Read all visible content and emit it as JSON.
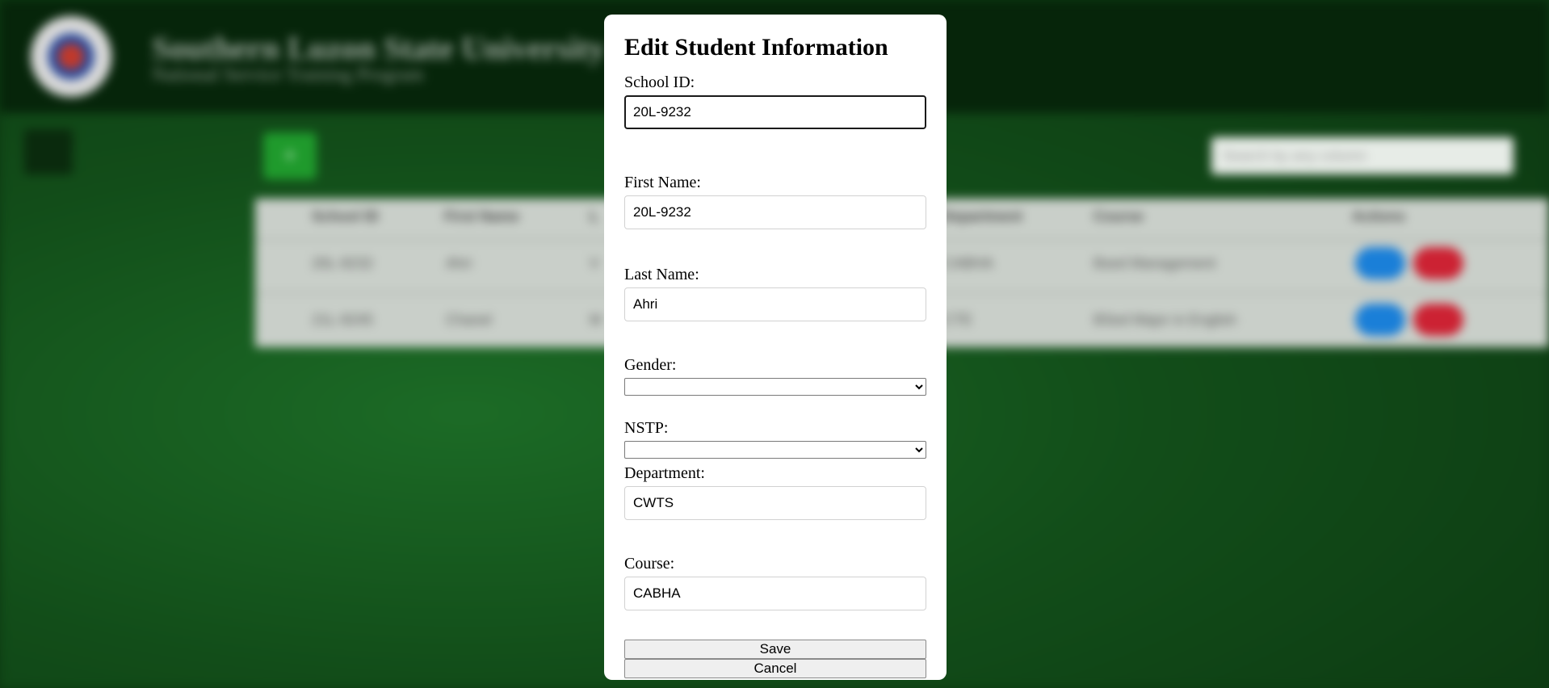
{
  "background": {
    "university_name": "Southern Luzon State University",
    "program_name": "National Service Training Program",
    "add_button_label": "+",
    "search_placeholder": "Search by any column",
    "table_headers": [
      "School ID",
      "First Name",
      "L",
      "Department",
      "Course",
      "Actions"
    ],
    "rows": [
      {
        "school_id": "20L-9232",
        "first_name": "Ahri",
        "last_initial": "V",
        "department": "CABHA",
        "course": "Bsed Management"
      },
      {
        "school_id": "21L-9245",
        "first_name": "Chanel",
        "last_initial": "M",
        "department": "CTE",
        "course": "BSed Major in English"
      }
    ]
  },
  "modal": {
    "title": "Edit Student Information",
    "fields": {
      "school_id": {
        "label": "School ID:",
        "value": "20L-9232"
      },
      "first_name": {
        "label": "First Name:",
        "value": "20L-9232"
      },
      "last_name": {
        "label": "Last Name:",
        "value": "Ahri"
      },
      "gender": {
        "label": "Gender:",
        "value": ""
      },
      "nstp": {
        "label": "NSTP:",
        "value": ""
      },
      "department": {
        "label": "Department:",
        "value": "CWTS"
      },
      "course": {
        "label": "Course:",
        "value": "CABHA"
      }
    },
    "save_label": "Save",
    "cancel_label": "Cancel"
  },
  "colors": {
    "header_bg": "#06250a",
    "page_bg": "#124d19",
    "add_button": "#1f9a2c",
    "edit_button": "#1a7fd8",
    "delete_button": "#cc2233"
  }
}
